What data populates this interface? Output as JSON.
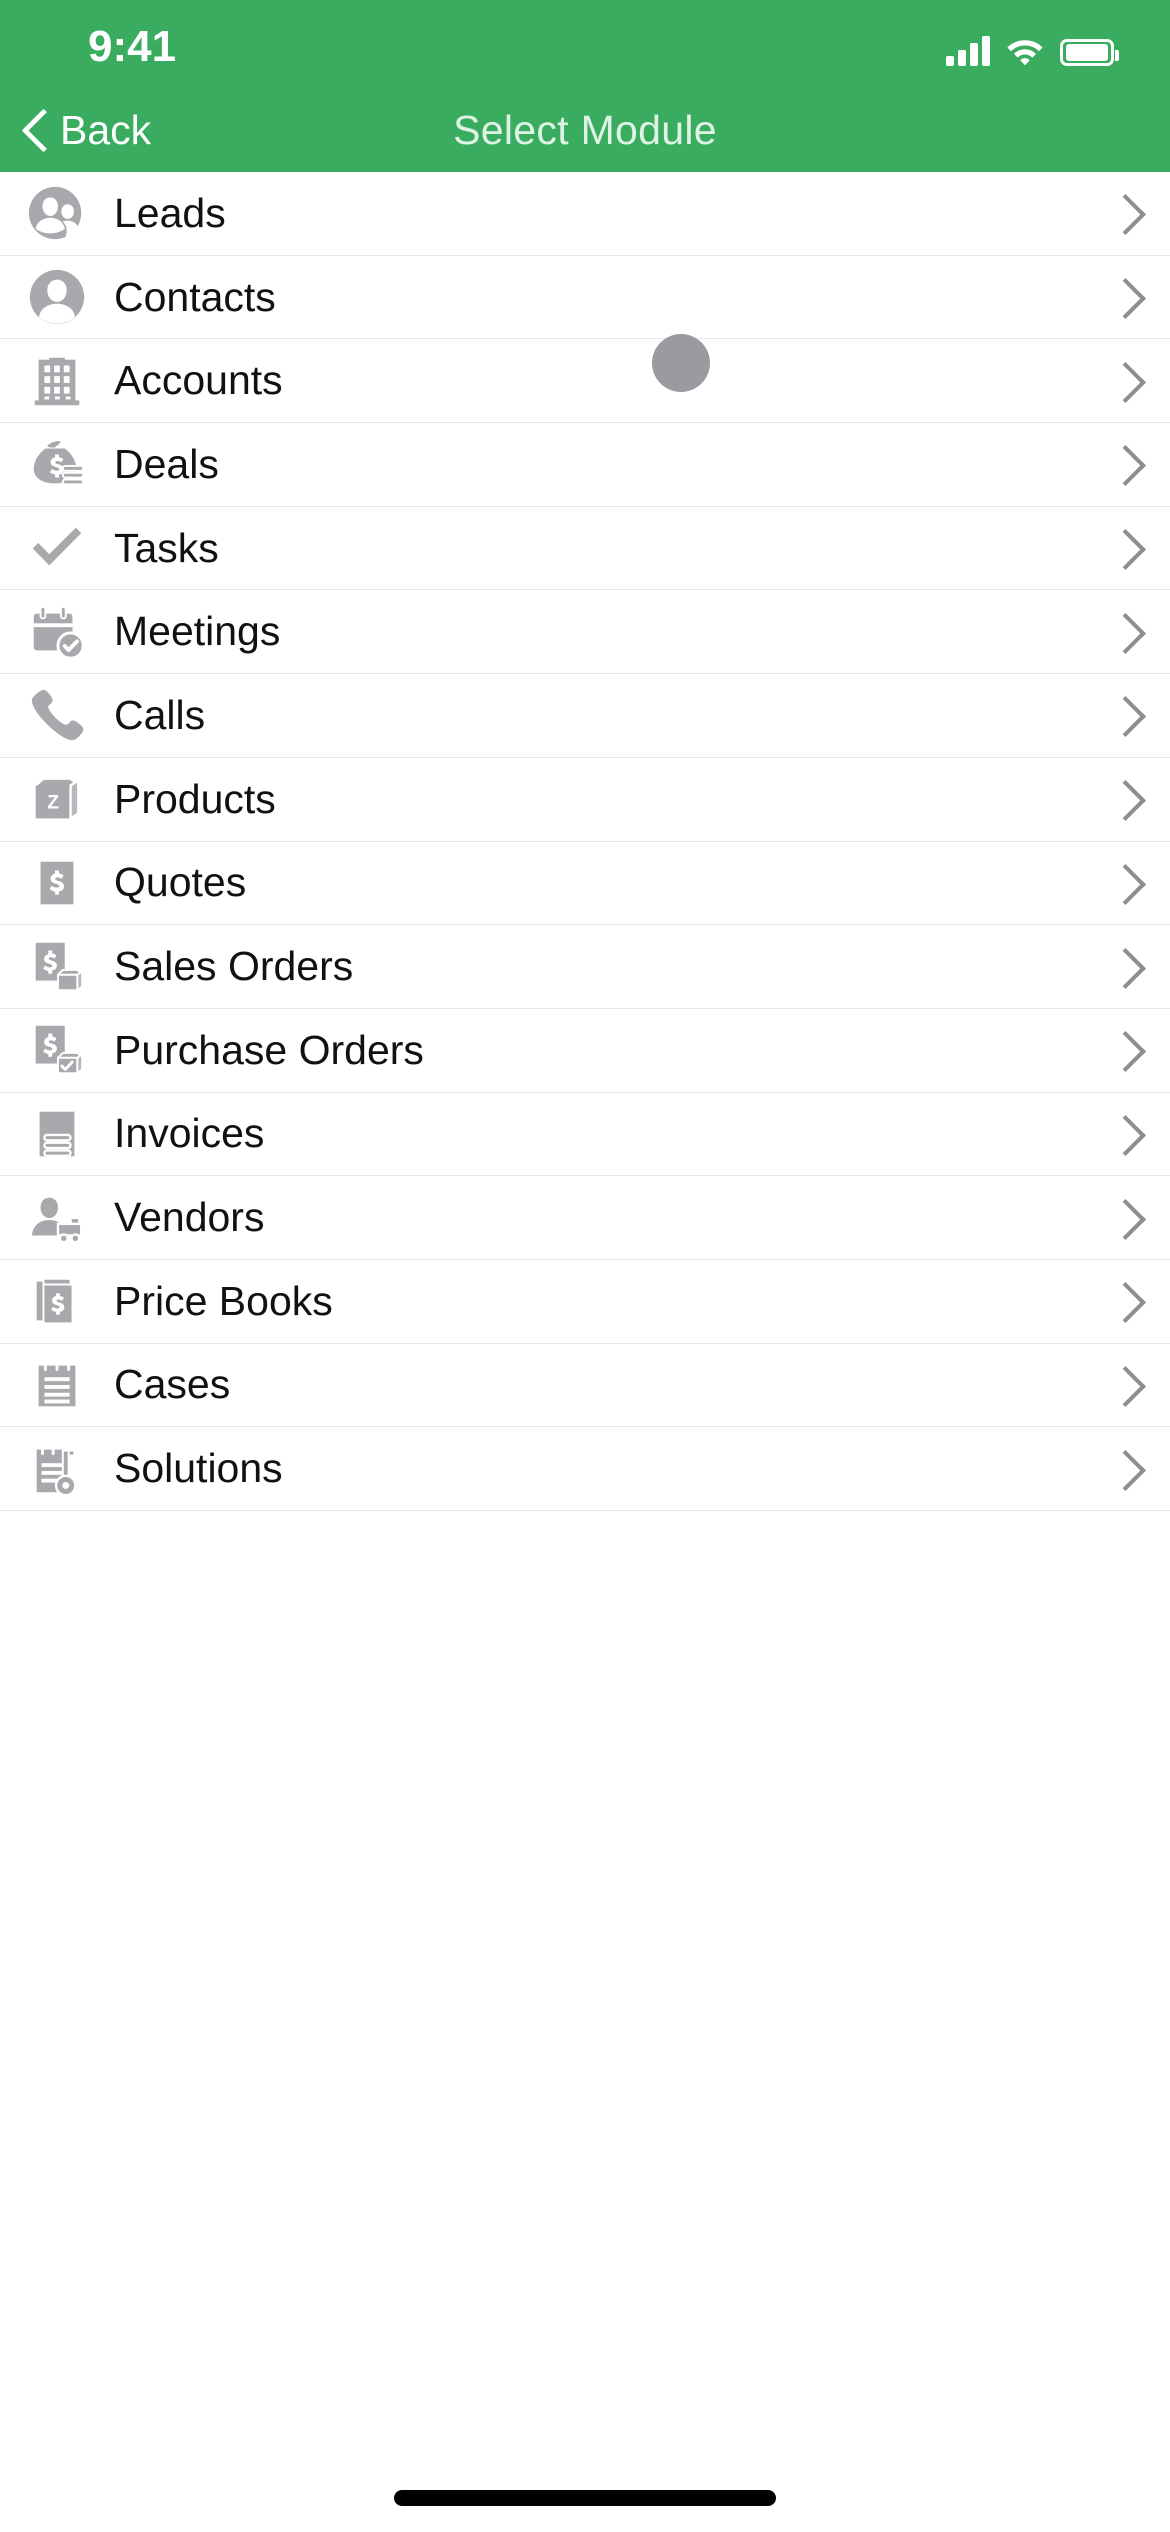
{
  "theme": {
    "accent_green": "#39ac5f",
    "icon_grey": "#a9a9ad",
    "divider": "#e8e8e8",
    "title_text": "#dff3e5",
    "row_text": "#111111",
    "chevron": "#8d8d92"
  },
  "status_bar": {
    "time": "9:41",
    "cellular_icon": "signal-bars-icon",
    "wifi_icon": "wifi-icon",
    "battery_icon": "battery-full-icon"
  },
  "nav_bar": {
    "back_label": "Back",
    "back_icon": "chevron-left-icon",
    "title": "Select Module"
  },
  "list": {
    "chevron_icon": "chevron-right-icon",
    "items": [
      {
        "label": "Leads",
        "icon": "two-people-circle-icon"
      },
      {
        "label": "Contacts",
        "icon": "person-circle-icon"
      },
      {
        "label": "Accounts",
        "icon": "office-building-icon"
      },
      {
        "label": "Deals",
        "icon": "money-bag-coins-icon"
      },
      {
        "label": "Tasks",
        "icon": "checkmark-icon"
      },
      {
        "label": "Meetings",
        "icon": "calendar-check-icon"
      },
      {
        "label": "Calls",
        "icon": "phone-handset-icon"
      },
      {
        "label": "Products",
        "icon": "box-z-icon"
      },
      {
        "label": "Quotes",
        "icon": "dollar-document-icon"
      },
      {
        "label": "Sales Orders",
        "icon": "dollar-document-box-icon"
      },
      {
        "label": "Purchase Orders",
        "icon": "dollar-document-box-check-icon"
      },
      {
        "label": "Invoices",
        "icon": "invoice-lines-icon"
      },
      {
        "label": "Vendors",
        "icon": "person-cart-icon"
      },
      {
        "label": "Price Books",
        "icon": "books-dollar-icon"
      },
      {
        "label": "Cases",
        "icon": "notepad-lines-icon"
      },
      {
        "label": "Solutions",
        "icon": "notepad-key-icon"
      }
    ]
  },
  "overlay": {
    "cursor_indicator": "touch-cursor-dot"
  },
  "home_indicator": "home-indicator-bar"
}
